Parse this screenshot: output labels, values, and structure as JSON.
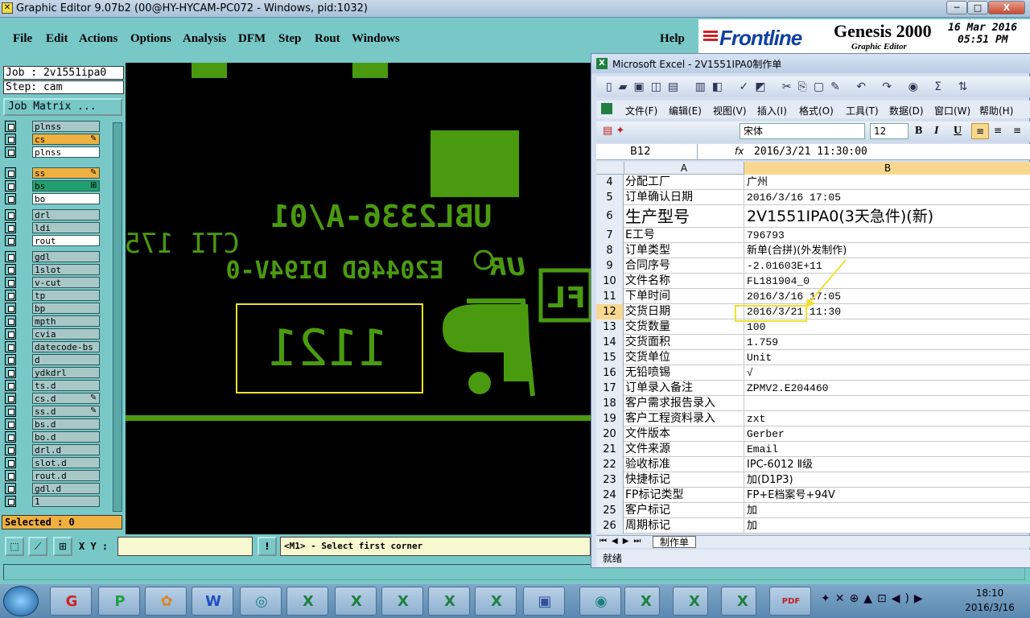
{
  "window": {
    "title": "Graphic Editor 9.07b2 (00@HY-HYCAM-PC072 - Windows, pid:1032)",
    "min": "─",
    "max": "□",
    "close": "X"
  },
  "menu": [
    "File",
    "Edit",
    "Actions",
    "Options",
    "Analysis",
    "DFM",
    "Step",
    "Rout",
    "Windows",
    "Help"
  ],
  "brand": {
    "logo": "Frontline",
    "product": "Genesis 2000",
    "sub": "Graphic Editor",
    "date": "16 Mar 2016",
    "time": "05:51 PM"
  },
  "job": {
    "job": "Job : 2v1551ipa0",
    "step": "Step: cam",
    "matrix_button": "Job Matrix ..."
  },
  "layers": [
    {
      "name": "plnss",
      "color": "#a8c8c8"
    },
    {
      "name": "cs",
      "color": "#f0b040",
      "mark": "✎"
    },
    {
      "name": "plnss",
      "color": "#ffffff"
    },
    {
      "name": "ss",
      "color": "#f0b040",
      "mark": "✎"
    },
    {
      "name": "bs",
      "color": "#20a070",
      "mark": "⊞"
    },
    {
      "name": "bo",
      "color": "#ffffff"
    },
    {
      "name": "drl",
      "color": "#a8c8c8"
    },
    {
      "name": "ldi",
      "color": "#a8c8c8"
    },
    {
      "name": "rout",
      "color": "#ffffff"
    },
    {
      "name": "gdl",
      "color": "#a8c8c8"
    },
    {
      "name": "1slot",
      "color": "#a8c8c8"
    },
    {
      "name": "v-cut",
      "color": "#a8c8c8"
    },
    {
      "name": "tp",
      "color": "#a8c8c8"
    },
    {
      "name": "bp",
      "color": "#a8c8c8"
    },
    {
      "name": "mpth",
      "color": "#a8c8c8"
    },
    {
      "name": "cvia",
      "color": "#a8c8c8"
    },
    {
      "name": "datecode-bs",
      "color": "#a8c8c8"
    },
    {
      "name": "d",
      "color": "#a8c8c8"
    },
    {
      "name": "ydkdrl",
      "color": "#a8c8c8"
    },
    {
      "name": "ts.d",
      "color": "#a8c8c8"
    },
    {
      "name": "cs.d",
      "color": "#a8c8c8",
      "mark": "✎"
    },
    {
      "name": "ss.d",
      "color": "#a8c8c8",
      "mark": "✎"
    },
    {
      "name": "bs.d",
      "color": "#a8c8c8"
    },
    {
      "name": "bo.d",
      "color": "#a8c8c8"
    },
    {
      "name": "drl.d",
      "color": "#a8c8c8"
    },
    {
      "name": "slot.d",
      "color": "#a8c8c8"
    },
    {
      "name": "rout.d",
      "color": "#a8c8c8"
    },
    {
      "name": "gdl.d",
      "color": "#a8c8c8"
    },
    {
      "name": "1",
      "color": "#a8c8c8"
    }
  ],
  "selected": "Selected : 0",
  "canvas": {
    "text1": "UBL2336-A/01",
    "text2": "CTI 175",
    "text3": "E20446D DI94V-0",
    "text4": "1121",
    "text5": "FL",
    "text6": "UR"
  },
  "bottom": {
    "xy_label": "X Y :",
    "xy_value": "",
    "prompt": "<M1> - Select first corner"
  },
  "excel": {
    "title": "Microsoft Excel - 2V1551IPA0制作单",
    "menu": [
      "文件(F)",
      "编辑(E)",
      "视图(V)",
      "插入(I)",
      "格式(O)",
      "工具(T)",
      "数据(D)",
      "窗口(W)",
      "帮助(H)"
    ],
    "font": "宋体",
    "size": "12",
    "cell_ref": "B12",
    "fx": "fx",
    "formula": "2016/3/21  11:30:00",
    "col_a": "A",
    "col_b": "B",
    "rows": [
      {
        "n": "4",
        "a": "分配工厂",
        "b": "广州"
      },
      {
        "n": "5",
        "a": "订单确认日期",
        "b": "2016/3/16 17:05"
      },
      {
        "n": "6",
        "a": "生产型号",
        "b": "2V1551IPA0(3天急件)(新)"
      },
      {
        "n": "7",
        "a": "E工号",
        "b": "796793"
      },
      {
        "n": "8",
        "a": "订单类型",
        "b": "新单(合拼)(外发制作)"
      },
      {
        "n": "9",
        "a": "合同序号",
        "b": "-2.01603E+11"
      },
      {
        "n": "10",
        "a": "文件名称",
        "b": "FL181904_0"
      },
      {
        "n": "11",
        "a": "下单时间",
        "b": "2016/3/16 17:05"
      },
      {
        "n": "12",
        "a": "交货日期",
        "b": "2016/3/21 11:30"
      },
      {
        "n": "13",
        "a": "交货数量",
        "b": "100"
      },
      {
        "n": "14",
        "a": "交货面积",
        "b": "1.759"
      },
      {
        "n": "15",
        "a": "交货单位",
        "b": "Unit"
      },
      {
        "n": "16",
        "a": "无铅喷锡",
        "b": "√"
      },
      {
        "n": "17",
        "a": "订单录入备注",
        "b": "ZPMV2.E204460"
      },
      {
        "n": "18",
        "a": "客户需求报告录入",
        "b": ""
      },
      {
        "n": "19",
        "a": "客户工程资料录入",
        "b": "zxt"
      },
      {
        "n": "20",
        "a": "文件版本",
        "b": "Gerber"
      },
      {
        "n": "21",
        "a": "文件来源",
        "b": "Email"
      },
      {
        "n": "22",
        "a": "验收标准",
        "b": "IPC-6012 Ⅱ级"
      },
      {
        "n": "23",
        "a": "快捷标记",
        "b": "加(D1P3)"
      },
      {
        "n": "24",
        "a": "FP标记类型",
        "b": "FP+E档案号+94V"
      },
      {
        "n": "25",
        "a": "客户标记",
        "b": "加"
      },
      {
        "n": "26",
        "a": "周期标记",
        "b": "加"
      }
    ],
    "sheet_tab": "制作单",
    "status": "就绪"
  },
  "taskbar": {
    "time": "18:10",
    "date": "2016/3/16",
    "items": [
      "G",
      "P",
      "✿",
      "W",
      "◎",
      "X",
      "X",
      "X",
      "X",
      "X",
      "▣",
      "◉",
      "X",
      "X",
      "X",
      "PDF"
    ]
  },
  "colors": {
    "teal": "#78c8c8",
    "pcb_green": "#4a9a10",
    "highlight": "#f0e030"
  }
}
